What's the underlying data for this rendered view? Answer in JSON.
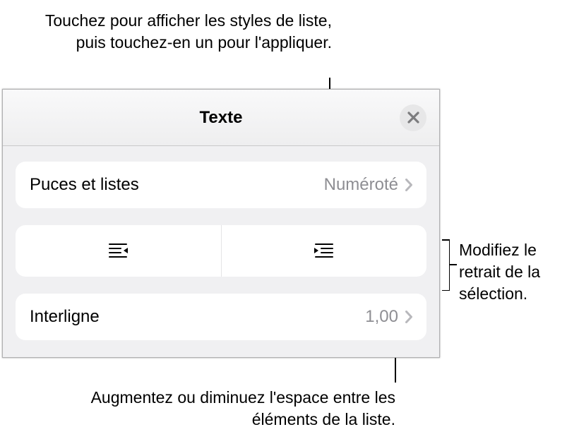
{
  "callouts": {
    "top": "Touchez pour afficher les styles de liste, puis touchez-en un pour l'appliquer.",
    "right": "Modifiez le retrait de la sélection.",
    "bottom": "Augmentez ou diminuez l'espace entre les éléments de la liste."
  },
  "panel": {
    "title": "Texte",
    "rows": {
      "bullets": {
        "label": "Puces et listes",
        "value": "Numéroté"
      },
      "lineSpacing": {
        "label": "Interligne",
        "value": "1,00"
      }
    }
  }
}
